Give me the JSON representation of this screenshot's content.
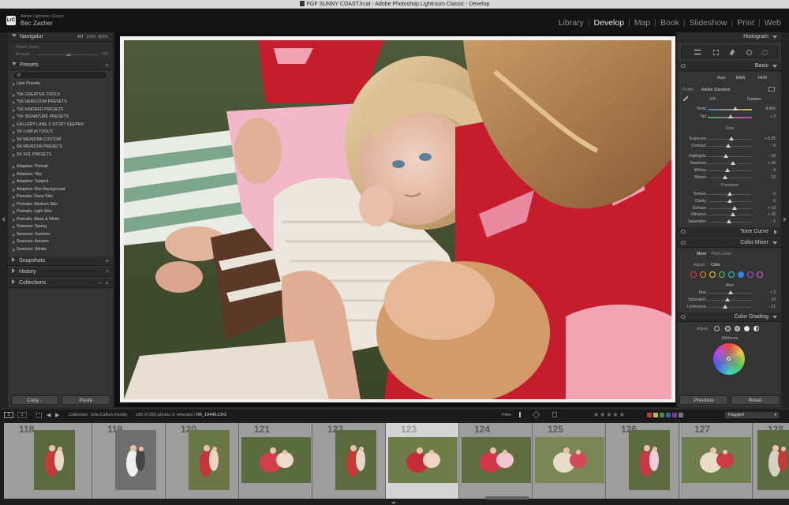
{
  "titlebar": {
    "title": "FGF SUNNY COAST.lrcat - Adobe Photoshop Lightroom Classic - Develop"
  },
  "identity": {
    "app_name": "Adobe Lightroom Classic",
    "user_name": "Bec Zacher",
    "logo_text": "LrC"
  },
  "modules": [
    "Library",
    "Develop",
    "Map",
    "Book",
    "Slideshow",
    "Print",
    "Web"
  ],
  "active_module": "Develop",
  "left_panel": {
    "navigator": {
      "label": "Navigator",
      "zoom_options": [
        "FIT",
        "100%",
        "800%"
      ]
    },
    "preset_amount": {
      "label": "Preset: None",
      "amount_label": "Amount",
      "amount_value": "100"
    },
    "presets": {
      "label": "Presets",
      "user_presets": "User Presets",
      "group1": [
        "*SK CREATIVE TOOLS",
        "*SK HEIRLOOM PRESETS",
        "*SK KINDRED PRESETS",
        "*SK SIGNATURE PRESETS",
        "GALLERY LANE X STORY KEEPER",
        "SK LUMI AI TOOLS",
        "SK MEADOW CUSTOM",
        "SK MEADOW PRESETS",
        "SK SOL PRESETS"
      ],
      "group2": [
        "Adaptive: Portrait",
        "Adaptive: Sky",
        "Adaptive: Subject",
        "Adaptive: Blur Background",
        "Portraits: Deep Skin",
        "Portraits: Medium Skin",
        "Portraits: Light Skin",
        "Portraits: Black & White",
        "Seasons: Spring",
        "Seasons: Summer",
        "Seasons: Autumn",
        "Seasons: Winter"
      ]
    },
    "snapshots": "Snapshots",
    "history": "History",
    "collections": "Collections",
    "copy_button": "Copy...",
    "paste_button": "Paste"
  },
  "right_panel": {
    "histogram": "Histogram",
    "basic": {
      "label": "Basic",
      "treatment": [
        "Auto",
        "B&W",
        "HDR"
      ],
      "profile_label": "Profile:",
      "profile_value": "Adobe Standard",
      "wb_label": "WB:",
      "wb_value": "Custom",
      "temp": {
        "label": "Temp",
        "value": "8,492",
        "pos": 0.63
      },
      "tint": {
        "label": "Tint",
        "value": "+ 3",
        "pos": 0.52
      },
      "tone_label": "Tone",
      "tone": [
        {
          "label": "Exposure",
          "value": "+ 0.25",
          "pos": 0.53
        },
        {
          "label": "Contrast",
          "value": "- 5",
          "pos": 0.47
        }
      ],
      "tone2": [
        {
          "label": "Highlights",
          "value": "- 18",
          "pos": 0.41
        },
        {
          "label": "Shadows",
          "value": "+ 16",
          "pos": 0.58
        },
        {
          "label": "Whites",
          "value": "- 9",
          "pos": 0.45
        },
        {
          "label": "Blacks",
          "value": "- 22",
          "pos": 0.39
        }
      ],
      "presence_label": "Presence",
      "presence": [
        {
          "label": "Texture",
          "value": "0",
          "pos": 0.5
        },
        {
          "label": "Clarity",
          "value": "0",
          "pos": 0.5
        },
        {
          "label": "Dehaze",
          "value": "+ 19",
          "pos": 0.6
        }
      ],
      "presence2": [
        {
          "label": "Vibrance",
          "value": "+ 16",
          "pos": 0.58
        },
        {
          "label": "Saturation",
          "value": "- 1",
          "pos": 0.49
        }
      ]
    },
    "tone_curve": "Tone Curve",
    "color_mixer": {
      "label": "Color Mixer",
      "tabs": [
        "Mixer",
        "Point Color"
      ],
      "adjust_label": "Adjust:",
      "adjust_value": "Color",
      "swatches": [
        "#e23b5a",
        "#f08a2a",
        "#e8d32a",
        "#5fd35a",
        "#3ad0c8",
        "#3a7ee8",
        "#a05ae8",
        "#e05ad0"
      ],
      "selected_swatch": 5,
      "channel": "Blue",
      "sliders": [
        {
          "label": "Hue",
          "value": "+ 2",
          "pos": 0.52
        },
        {
          "label": "Saturation",
          "value": "- 10",
          "pos": 0.45
        },
        {
          "label": "Luminance",
          "value": "- 21",
          "pos": 0.39
        }
      ]
    },
    "color_grading": {
      "label": "Color Grading",
      "adjust_label": "Adjust:",
      "wheel_label": "Midtones"
    },
    "previous_button": "Previous",
    "reset_button": "Reset"
  },
  "filmstrip_bar": {
    "pages": [
      "1",
      "2"
    ],
    "collection": "Collection : Ella Callum Family",
    "count": "189 of 283 photos /1 selected /",
    "filename": "R6_10446.CR3",
    "filter_label": "Filter :",
    "flag_filter": "Flagged"
  },
  "filmstrip": {
    "numbers": [
      "118",
      "119",
      "120",
      "121",
      "122",
      "123",
      "124",
      "125",
      "126",
      "127",
      "128"
    ],
    "selected_index": 5
  }
}
